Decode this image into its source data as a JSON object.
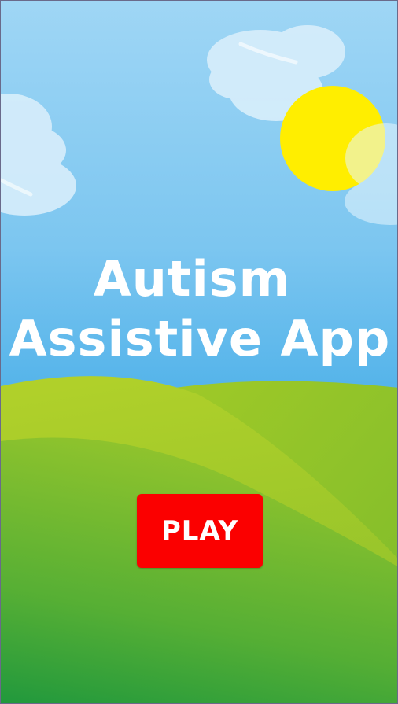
{
  "app": {
    "title_line1": "Autism",
    "title_line2": "Assistive App"
  },
  "actions": {
    "play_label": "PLAY"
  },
  "colors": {
    "sky_top": "#9fd6f5",
    "sky_bottom": "#4aaee6",
    "hill_light": "#a6cc2a",
    "hill_dark": "#0e9240",
    "sun": "#ffee00",
    "play_button": "#fb0000",
    "text": "#ffffff"
  },
  "icons": [
    "cloud-icon",
    "sun-icon"
  ]
}
